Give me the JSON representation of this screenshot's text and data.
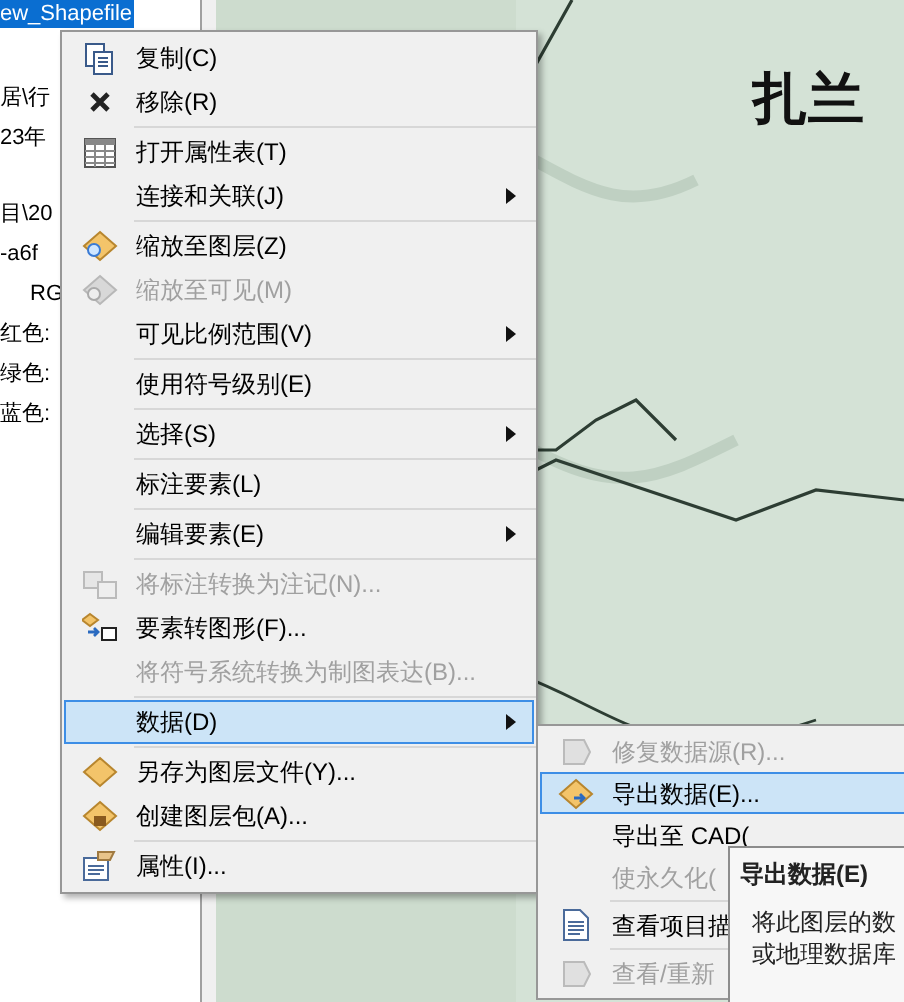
{
  "layers_panel": {
    "selected_layer": {
      "label": "ew_Shapefile",
      "selected": true
    },
    "lines": [
      "居\\行",
      "23年",
      "目\\20",
      "-a6f",
      "RG",
      "红色:",
      "绿色:",
      "蓝色:"
    ]
  },
  "map": {
    "labels": [
      "扎兰"
    ]
  },
  "context_menu": {
    "items": [
      {
        "label": "复制(C)",
        "disabled": false,
        "submenu": false,
        "selected": false,
        "separator_before": false
      },
      {
        "label": "移除(R)",
        "disabled": false,
        "submenu": false,
        "selected": false,
        "separator_before": false
      },
      {
        "label": "打开属性表(T)",
        "disabled": false,
        "submenu": false,
        "selected": false,
        "separator_before": true
      },
      {
        "label": "连接和关联(J)",
        "disabled": false,
        "submenu": true,
        "selected": false,
        "separator_before": false
      },
      {
        "label": "缩放至图层(Z)",
        "disabled": false,
        "submenu": false,
        "selected": false,
        "separator_before": true
      },
      {
        "label": "缩放至可见(M)",
        "disabled": true,
        "submenu": false,
        "selected": false,
        "separator_before": false
      },
      {
        "label": "可见比例范围(V)",
        "disabled": false,
        "submenu": true,
        "selected": false,
        "separator_before": false
      },
      {
        "label": "使用符号级别(E)",
        "disabled": false,
        "submenu": false,
        "selected": false,
        "separator_before": true
      },
      {
        "label": "选择(S)",
        "disabled": false,
        "submenu": true,
        "selected": false,
        "separator_before": true
      },
      {
        "label": "标注要素(L)",
        "disabled": false,
        "submenu": false,
        "selected": false,
        "separator_before": true
      },
      {
        "label": "编辑要素(E)",
        "disabled": false,
        "submenu": true,
        "selected": false,
        "separator_before": true
      },
      {
        "label": "将标注转换为注记(N)...",
        "disabled": true,
        "submenu": false,
        "selected": false,
        "separator_before": true
      },
      {
        "label": "要素转图形(F)...",
        "disabled": false,
        "submenu": false,
        "selected": false,
        "separator_before": false
      },
      {
        "label": "将符号系统转换为制图表达(B)...",
        "disabled": true,
        "submenu": false,
        "selected": false,
        "separator_before": false
      },
      {
        "label": "数据(D)",
        "disabled": false,
        "submenu": true,
        "selected": true,
        "separator_before": true
      },
      {
        "label": "另存为图层文件(Y)...",
        "disabled": false,
        "submenu": false,
        "selected": false,
        "separator_before": true
      },
      {
        "label": "创建图层包(A)...",
        "disabled": false,
        "submenu": false,
        "selected": false,
        "separator_before": false
      },
      {
        "label": "属性(I)...",
        "disabled": false,
        "submenu": false,
        "selected": false,
        "separator_before": true
      }
    ]
  },
  "data_submenu": {
    "items": [
      {
        "label": "修复数据源(R)...",
        "disabled": true,
        "selected": false,
        "separator_before": false
      },
      {
        "label": "导出数据(E)...",
        "disabled": false,
        "selected": true,
        "separator_before": false
      },
      {
        "label": "导出至 CAD(",
        "disabled": false,
        "selected": false,
        "separator_before": false
      },
      {
        "label": "使永久化(",
        "disabled": true,
        "selected": false,
        "separator_before": false
      },
      {
        "label": "查看项目描",
        "disabled": false,
        "selected": false,
        "separator_before": true
      },
      {
        "label": "查看/重新",
        "disabled": true,
        "selected": false,
        "separator_before": true
      }
    ]
  },
  "tooltip": {
    "title": "导出数据(E)",
    "lines": [
      "将此图层的数",
      "或地理数据库"
    ]
  }
}
